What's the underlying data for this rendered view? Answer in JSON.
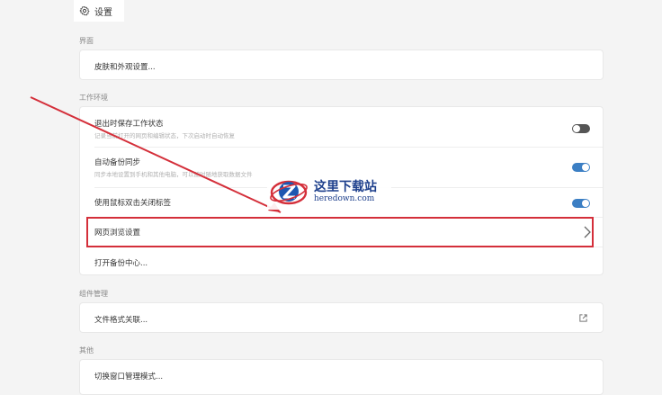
{
  "window": {
    "title": "设置"
  },
  "sections": {
    "appearance": {
      "label": "界面",
      "skin_label": "皮肤和外观设置..."
    },
    "workspace": {
      "label": "工作环境",
      "save_on_exit": {
        "label": "退出时保存工作状态",
        "desc": "记录当前打开的网页和编辑状态，下次启动时自动恢复",
        "enabled": false
      },
      "auto_backup": {
        "label": "自动备份同步",
        "desc": "同步本地设置到手机和其他电脑，可以随时随地获取数据文件",
        "enabled": true
      },
      "double_click_close": {
        "label": "使用鼠标双击关闭标签",
        "enabled": true
      },
      "web_browse_label": "网页浏览设置",
      "backup_center_label": "打开备份中心..."
    },
    "components": {
      "label": "组件管理",
      "file_assoc_label": "文件格式关联..."
    },
    "other": {
      "label": "其他",
      "window_mode_label": "切换窗口管理模式..."
    }
  },
  "watermark": {
    "cn": "这里下载站",
    "en": "heredown.com"
  },
  "colors": {
    "toggle_on": "#3c7fc4",
    "toggle_off": "#555555",
    "highlight": "#d42f3a"
  }
}
